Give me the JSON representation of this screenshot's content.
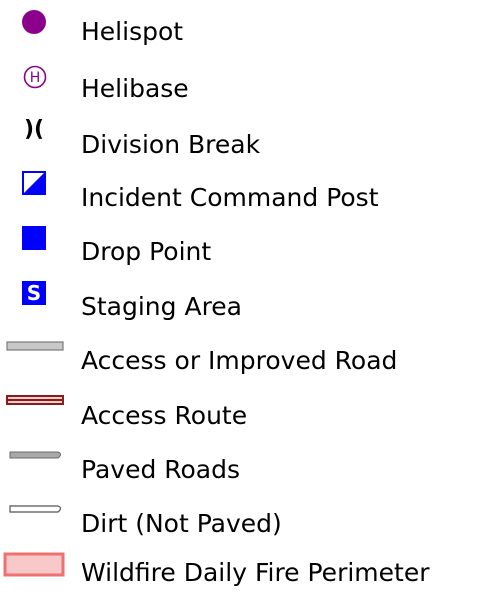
{
  "legend": {
    "items": [
      {
        "icon": "helispot-icon",
        "color": "#8b008b",
        "label": "Helispot"
      },
      {
        "icon": "helibase-icon",
        "color": "#8b008b",
        "label": "Helibase",
        "glyph": "H"
      },
      {
        "icon": "division-break-icon",
        "color": "#000000",
        "label": "Division Break",
        "glyph": ")("
      },
      {
        "icon": "incident-command-post-icon",
        "color": "#0000ff",
        "label": "Incident Command Post"
      },
      {
        "icon": "drop-point-icon",
        "color": "#0000ff",
        "label": "Drop Point"
      },
      {
        "icon": "staging-area-icon",
        "color": "#0000ff",
        "label": "Staging Area",
        "glyph": "S"
      },
      {
        "icon": "access-or-improved-road-icon",
        "color": "#b0b0b0",
        "label": "Access or Improved Road"
      },
      {
        "icon": "access-route-icon",
        "color": "#8b1a1a",
        "label": "Access Route"
      },
      {
        "icon": "paved-roads-icon",
        "color": "#a8a8a8",
        "label": "Paved Roads"
      },
      {
        "icon": "dirt-road-icon",
        "color": "#ffffff",
        "label": "Dirt (Not Paved)"
      },
      {
        "icon": "wildfire-daily-fire-perimeter-icon",
        "color": "#f07070",
        "label": "Wildfire Daily Fire Perimeter"
      }
    ]
  }
}
